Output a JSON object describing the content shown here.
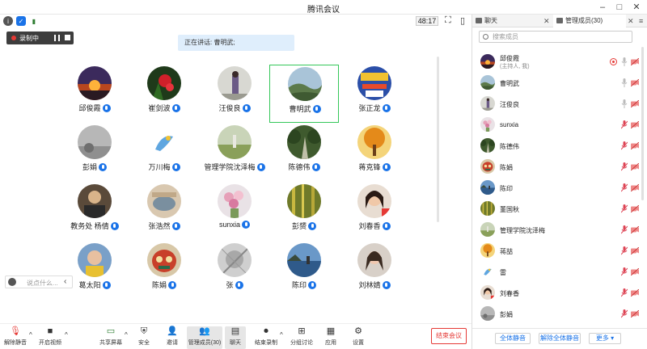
{
  "window": {
    "title": "腾讯会议",
    "timer": "48:17"
  },
  "recording": {
    "label": "录制中"
  },
  "speaking": {
    "text": "正在讲话: 曹明武;"
  },
  "chat": {
    "placeholder": "说点什么..."
  },
  "participants_grid": [
    {
      "name": "邱俊霞",
      "avatar": "sunset"
    },
    {
      "name": "崔剑波",
      "avatar": "redflower"
    },
    {
      "name": "汪俊良",
      "avatar": "person"
    },
    {
      "name": "曹明武",
      "avatar": "hills",
      "active": true
    },
    {
      "name": "张正龙",
      "avatar": "poster"
    },
    {
      "name": "彭娟",
      "avatar": "grey"
    },
    {
      "name": "万川梅",
      "avatar": "bird"
    },
    {
      "name": "管理学院沈泽梅",
      "avatar": "field"
    },
    {
      "name": "陈德伟",
      "avatar": "road"
    },
    {
      "name": "蒋克锋",
      "avatar": "tree"
    },
    {
      "name": "教务处 杨倩",
      "avatar": "portrait"
    },
    {
      "name": "张浩然",
      "avatar": "hand"
    },
    {
      "name": "sunxia",
      "avatar": "flowers"
    },
    {
      "name": "彭赟",
      "avatar": "forest"
    },
    {
      "name": "刘春香",
      "avatar": "girl"
    },
    {
      "name": "葛太阳",
      "avatar": "kid"
    },
    {
      "name": "陈娟",
      "avatar": "mask"
    },
    {
      "name": "张",
      "avatar": "sketch"
    },
    {
      "name": "陈印",
      "avatar": "lake"
    },
    {
      "name": "刘林婧",
      "avatar": "woman"
    }
  ],
  "toolbar": {
    "unmute": "解除静音",
    "start_video": "开启视频",
    "share": "共享屏幕",
    "security": "安全",
    "invite": "邀请",
    "members": "管理成员(30)",
    "chat": "聊天",
    "end_record": "结束录制",
    "breakout": "分组讨论",
    "apps": "应用",
    "settings": "设置",
    "end_meeting": "结束会议"
  },
  "panel": {
    "tab_chat": "聊天",
    "tab_members": "管理成员(30)",
    "search_placeholder": "搜索成员",
    "members": [
      {
        "name": "邱俊霞",
        "sub": "(主持人, 我)",
        "avatar": "sunset",
        "mic": "on",
        "self": true
      },
      {
        "name": "曹明武",
        "avatar": "hills",
        "mic": "on"
      },
      {
        "name": "汪俊良",
        "avatar": "person",
        "mic": "on"
      },
      {
        "name": "sunxia",
        "avatar": "flowers",
        "mic": "off"
      },
      {
        "name": "陈德伟",
        "avatar": "road",
        "mic": "off"
      },
      {
        "name": "陈娟",
        "avatar": "mask",
        "mic": "off"
      },
      {
        "name": "陈印",
        "avatar": "lake",
        "mic": "off"
      },
      {
        "name": "董国秋",
        "avatar": "forest",
        "mic": "off"
      },
      {
        "name": "管理学院沈泽梅",
        "avatar": "field",
        "mic": "off"
      },
      {
        "name": "蒋喆",
        "avatar": "tree",
        "mic": "off"
      },
      {
        "name": "雷",
        "avatar": "bird",
        "mic": "off"
      },
      {
        "name": "刘春香",
        "avatar": "girl",
        "mic": "off"
      },
      {
        "name": "彭娟",
        "avatar": "grey",
        "mic": "off"
      }
    ],
    "mute_all": "全体静音",
    "unmute_all": "解除全体静音",
    "more": "更多 ▾"
  },
  "colors": {
    "accent": "#1a73e8",
    "active_border": "#34c759",
    "end_red": "#e53935"
  }
}
